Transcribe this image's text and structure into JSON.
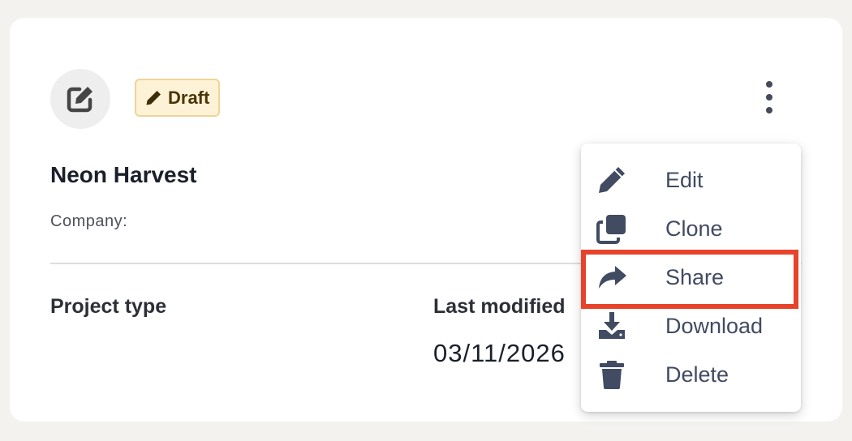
{
  "card": {
    "project_icon": "edit-square-icon",
    "status_badge": {
      "icon": "pencil-icon",
      "label": "Draft",
      "bg": "#fdf2d5",
      "border": "#eed598"
    },
    "more_menu_icon": "kebab-vertical-icon",
    "title": "Neon Harvest",
    "company_label": "Company:",
    "fields": {
      "project_type_label": "Project type",
      "last_modified_label": "Last modified",
      "last_modified_value": "03/11/2026"
    }
  },
  "context_menu": {
    "items": [
      {
        "label": "Edit",
        "icon": "pencil-icon"
      },
      {
        "label": "Clone",
        "icon": "clone-icon"
      },
      {
        "label": "Share",
        "icon": "share-arrow-icon"
      },
      {
        "label": "Download",
        "icon": "download-icon"
      },
      {
        "label": "Delete",
        "icon": "trash-icon"
      }
    ],
    "highlighted_item": "Share",
    "highlight_color": "#e6432a",
    "icon_color": "#414b61"
  }
}
